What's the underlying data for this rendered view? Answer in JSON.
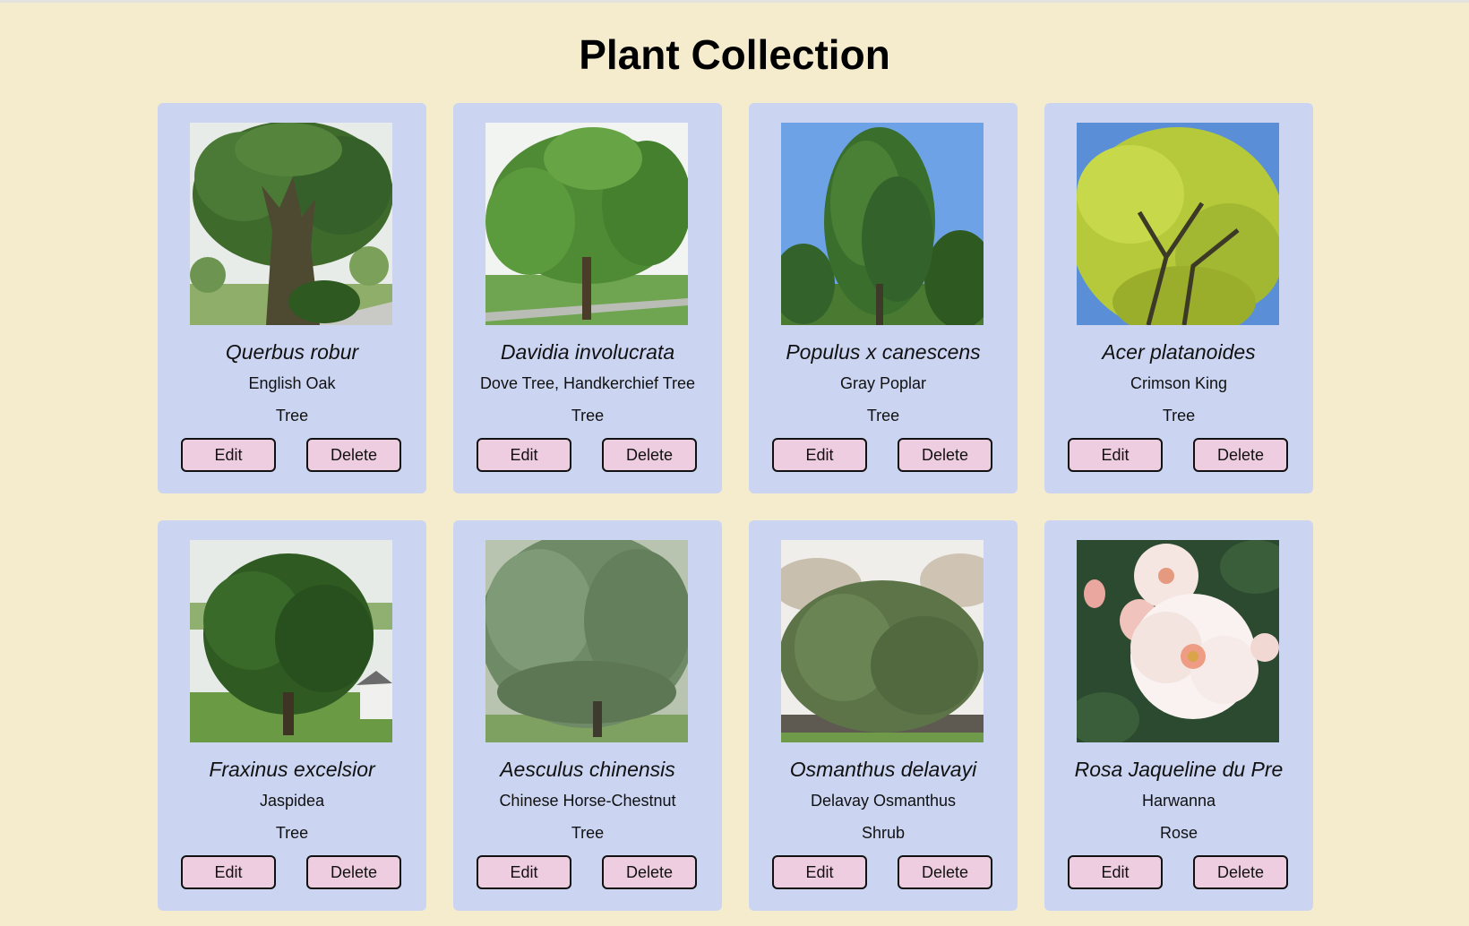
{
  "page": {
    "title": "Plant Collection"
  },
  "actions": {
    "edit_label": "Edit",
    "delete_label": "Delete"
  },
  "plants": [
    {
      "scientific_name": "Querbus robur",
      "common_name": "English Oak",
      "type": "Tree",
      "image": "oak-tree-photo"
    },
    {
      "scientific_name": "Davidia involucrata",
      "common_name": "Dove Tree, Handkerchief Tree",
      "type": "Tree",
      "image": "dove-tree-photo"
    },
    {
      "scientific_name": "Populus x canescens",
      "common_name": "Gray Poplar",
      "type": "Tree",
      "image": "poplar-tree-photo"
    },
    {
      "scientific_name": "Acer platanoides",
      "common_name": "Crimson King",
      "type": "Tree",
      "image": "maple-tree-photo"
    },
    {
      "scientific_name": "Fraxinus excelsior",
      "common_name": "Jaspidea",
      "type": "Tree",
      "image": "ash-tree-photo"
    },
    {
      "scientific_name": "Aesculus chinensis",
      "common_name": "Chinese Horse-Chestnut",
      "type": "Tree",
      "image": "horse-chestnut-photo"
    },
    {
      "scientific_name": "Osmanthus delavayi",
      "common_name": "Delavay Osmanthus",
      "type": "Shrub",
      "image": "osmanthus-shrub-photo"
    },
    {
      "scientific_name": "Rosa Jaqueline du Pre",
      "common_name": "Harwanna",
      "type": "Rose",
      "image": "white-rose-photo"
    }
  ],
  "colors": {
    "page_background": "#f5ebcd",
    "card_background": "#cbd5f2",
    "button_background": "#eecde0"
  }
}
